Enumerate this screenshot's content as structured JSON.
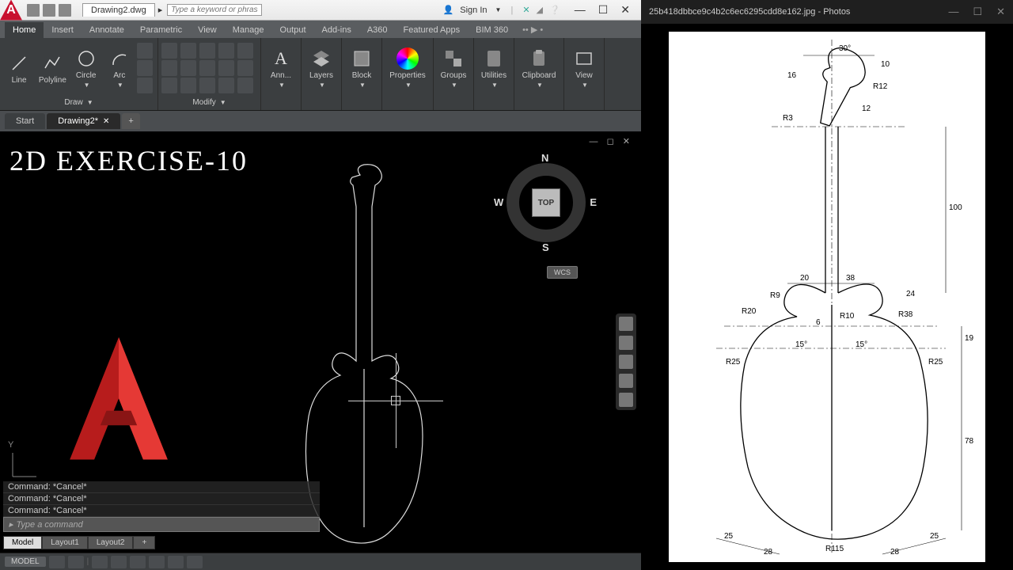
{
  "autocad": {
    "filename": "Drawing2.dwg",
    "search_placeholder": "Type a keyword or phrase",
    "signin": "Sign In",
    "ribbon_tabs": [
      "Home",
      "Insert",
      "Annotate",
      "Parametric",
      "View",
      "Manage",
      "Output",
      "Add-ins",
      "A360",
      "Featured Apps",
      "BIM 360"
    ],
    "active_tab": "Home",
    "panels": {
      "draw": {
        "title": "Draw",
        "items": [
          "Line",
          "Polyline",
          "Circle",
          "Arc"
        ]
      },
      "modify": {
        "title": "Modify"
      },
      "annotate": {
        "title": "Ann..."
      },
      "layers": {
        "title": "Layers"
      },
      "block": {
        "title": "Block"
      },
      "properties": {
        "title": "Properties"
      },
      "groups": {
        "title": "Groups"
      },
      "utilities": {
        "title": "Utilities"
      },
      "clipboard": {
        "title": "Clipboard"
      },
      "view": {
        "title": "View"
      }
    },
    "doc_tabs": [
      "Start",
      "Drawing2*"
    ],
    "overlay_text": "2D EXERCISE-10",
    "viewcube": {
      "face": "TOP",
      "n": "N",
      "s": "S",
      "e": "E",
      "w": "W"
    },
    "wcs": "WCS",
    "ucs_y": "Y",
    "command_history": [
      "Command: *Cancel*",
      "Command: *Cancel*",
      "Command: *Cancel*"
    ],
    "command_prompt": "Type a command",
    "layout_tabs": [
      "Model",
      "Layout1",
      "Layout2"
    ],
    "status_model": "MODEL"
  },
  "photos": {
    "title": "25b418dbbce9c4b2c6ec6295cdd8e162.jpg - Photos",
    "dimensions": {
      "angle_head": "30°",
      "head_r": "R12",
      "head_10": "10",
      "head_16": "16",
      "head_12": "12",
      "head_r3": "R3",
      "neck_100": "100",
      "body_top_20": "20",
      "body_top_38": "38",
      "r9": "R9",
      "r10": "R10",
      "r38": "R38",
      "dim_6": "6",
      "dim_19": "19",
      "dim_24": "24",
      "r20": "R20",
      "angle_15l": "15°",
      "angle_15r": "15°",
      "r25l": "R25",
      "r25r": "R25",
      "body_78": "78",
      "bottom_25l": "25",
      "bottom_25r": "25",
      "bottom_28l": "28",
      "bottom_28r": "28",
      "r115": "R115"
    }
  }
}
